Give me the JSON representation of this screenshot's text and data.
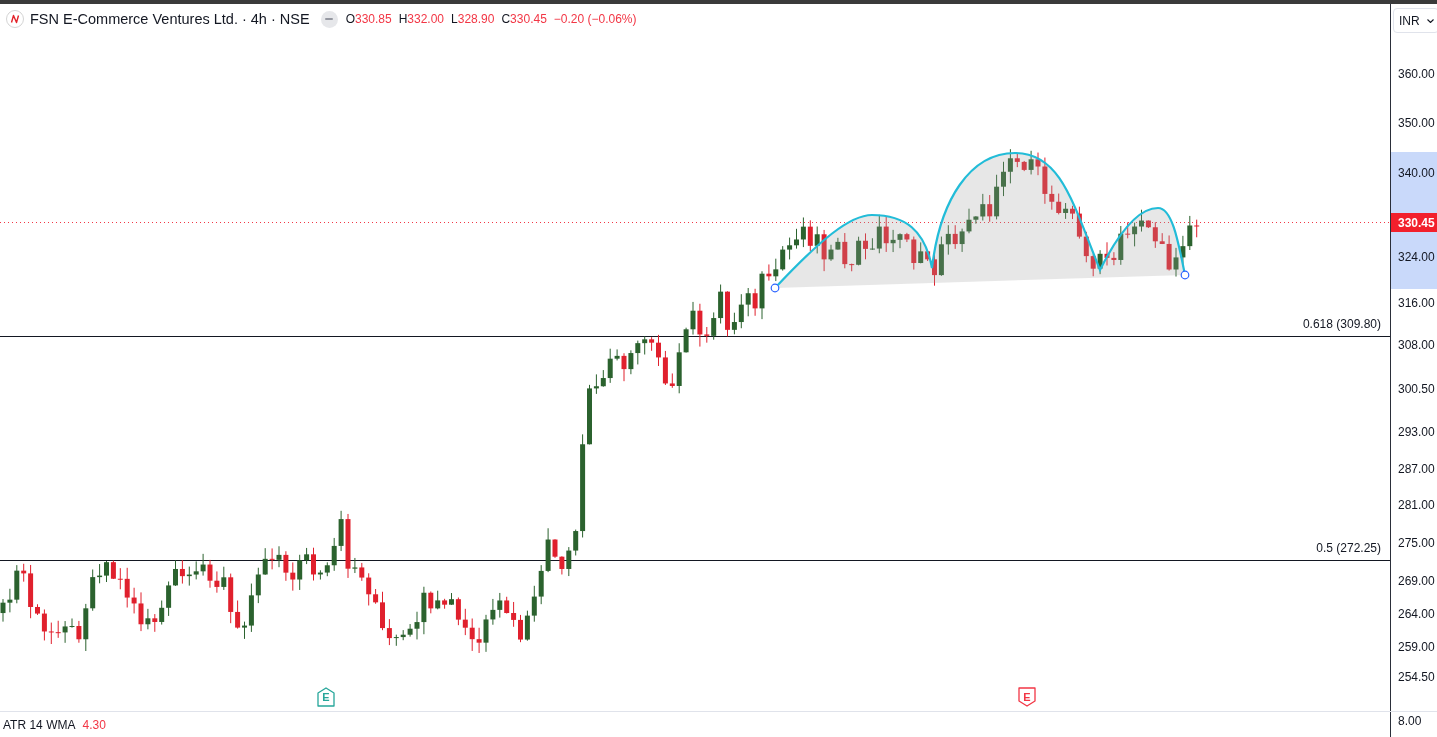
{
  "header": {
    "title": "FSN E-Commerce Ventures Ltd. · 4h · NSE",
    "ohlc": [
      {
        "label": "O",
        "value": "330.85"
      },
      {
        "label": "H",
        "value": "332.00"
      },
      {
        "label": "L",
        "value": "328.90"
      },
      {
        "label": "C",
        "value": "330.45"
      }
    ],
    "change": "−0.20 (−0.06%)"
  },
  "currency": "INR",
  "price_axis": {
    "labels": [
      "360.00",
      "350.00",
      "340.00",
      "324.00",
      "316.00",
      "308.00",
      "300.50",
      "293.00",
      "287.00",
      "281.00",
      "275.00",
      "269.00",
      "264.00",
      "259.00",
      "254.50"
    ],
    "current_price": "330.45"
  },
  "fibonacci_levels": [
    {
      "label": "0.618 (309.80)"
    },
    {
      "label": "0.5 (272.25)"
    }
  ],
  "earnings_markers": [
    {
      "letter": "E",
      "color": "#26a69a",
      "kind": "up"
    },
    {
      "letter": "E",
      "color": "#f23645",
      "kind": "down"
    }
  ],
  "indicator": {
    "name": "ATR 14 WMA",
    "value": "4.30",
    "axis_label": "8.00"
  }
}
